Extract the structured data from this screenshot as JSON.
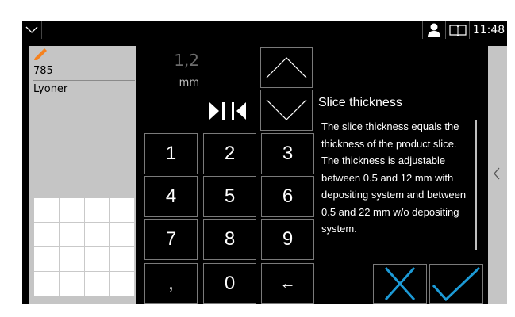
{
  "topbar": {
    "menu_icon": "chevron-down-icon",
    "user_icon": "user-icon",
    "book_icon": "book-icon",
    "time": "11:48"
  },
  "product": {
    "edit_icon": "pencil-icon",
    "number": "785",
    "name": "Lyoner"
  },
  "entry": {
    "value": "1,2",
    "unit": "mm"
  },
  "keypad": {
    "keys": [
      "1",
      "2",
      "3",
      "4",
      "5",
      "6",
      "7",
      "8",
      "9",
      ",",
      "0",
      "←"
    ]
  },
  "help": {
    "title": "Slice thickness",
    "text": "The slice thickness equals the thickness of the product slice. The thickness is adjustable between 0.5 and 12 mm with depositing system and between 0.5 and 22 mm w/o depositing system."
  },
  "colors": {
    "accent": "#1c9ad6",
    "panel_grey": "#c5c5c5",
    "pencil_orange": "#f5821f"
  }
}
